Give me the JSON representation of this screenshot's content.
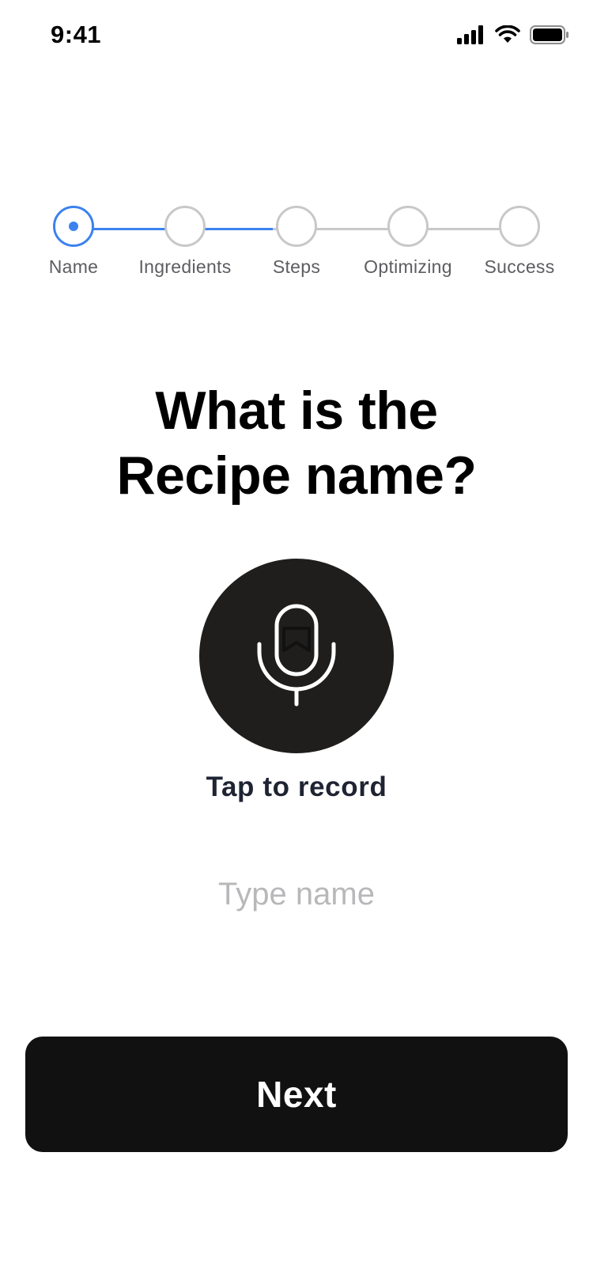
{
  "status_bar": {
    "time": "9:41",
    "icons": [
      "cellular-signal-icon",
      "wifi-icon",
      "battery-icon"
    ]
  },
  "stepper": {
    "current_index": 0,
    "progress_line_color": "#3b82f0",
    "inactive_line_color": "#c8c8cb",
    "steps": [
      {
        "label": "Name",
        "state": "active"
      },
      {
        "label": "Ingredients",
        "state": "upcoming"
      },
      {
        "label": "Steps",
        "state": "upcoming"
      },
      {
        "label": "Optimizing",
        "state": "upcoming"
      },
      {
        "label": "Success",
        "state": "upcoming"
      }
    ]
  },
  "heading": {
    "line1": "What is the",
    "line2": "Recipe name?"
  },
  "record": {
    "icon": "microphone-icon",
    "label": "Tap to record"
  },
  "name_input": {
    "value": "",
    "placeholder": "Type name"
  },
  "next_button": {
    "label": "Next"
  },
  "colors": {
    "accent": "#3b82f0",
    "button_bg": "#111111",
    "mic_bg": "#1f1e1d"
  }
}
